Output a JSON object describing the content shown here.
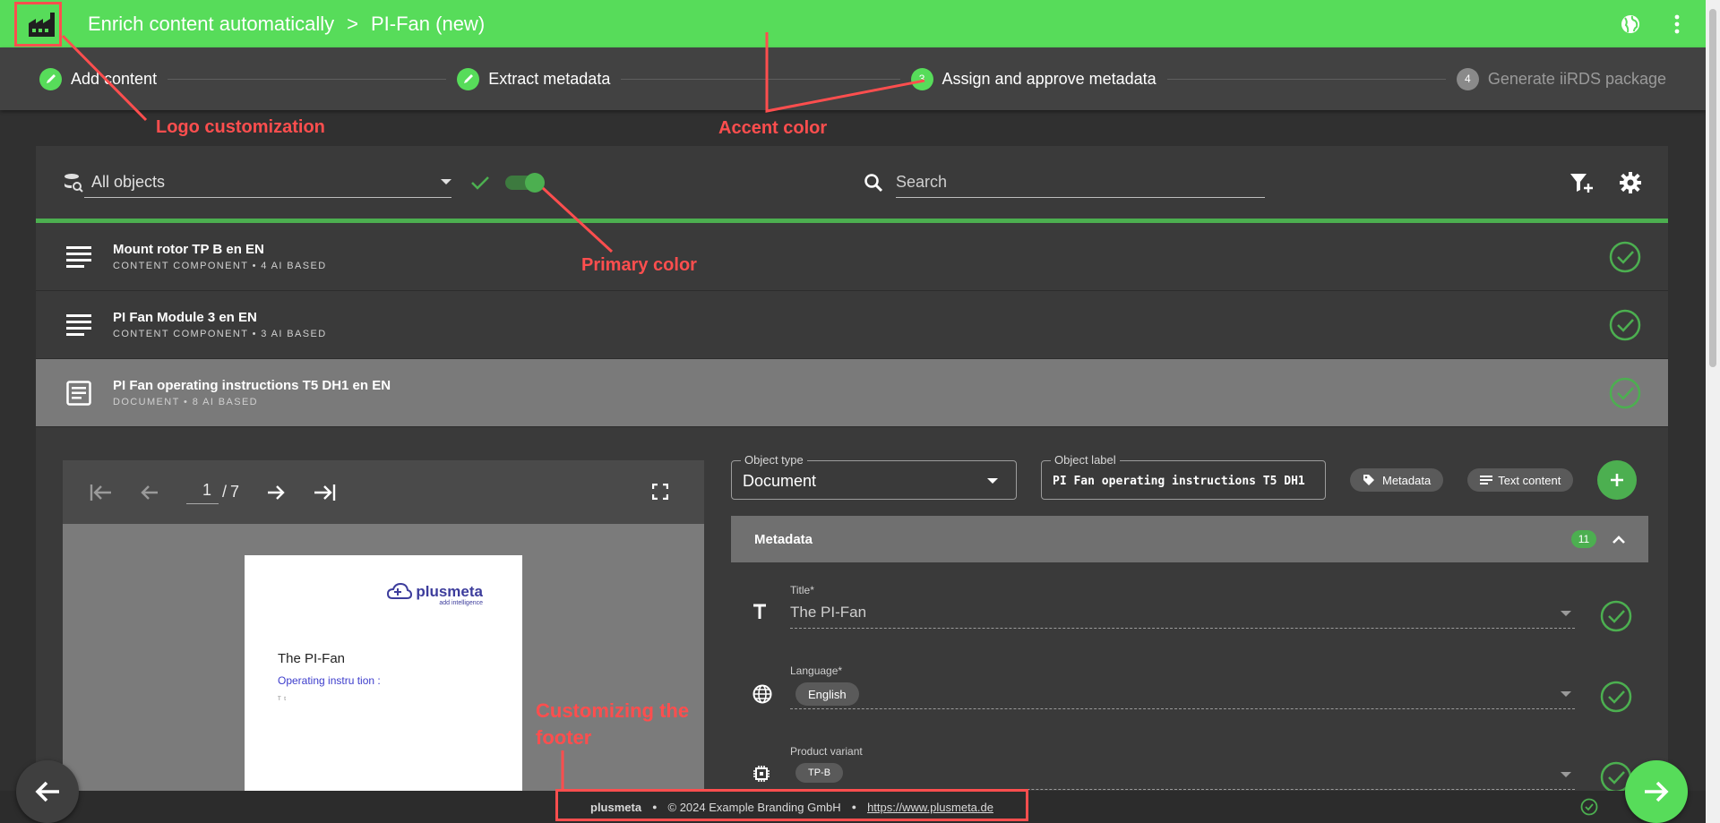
{
  "colors": {
    "accent": "#57dc5a",
    "primary": "#4caf50",
    "annotation": "#ff4e4e"
  },
  "header": {
    "breadcrumb_root": "Enrich content automatically",
    "breadcrumb_sep": ">",
    "breadcrumb_current": "PI-Fan (new)",
    "logo_icon": "factory-icon",
    "icons": [
      "globe-icon",
      "more-vert-icon"
    ]
  },
  "stepper": {
    "steps": [
      {
        "label": "Add content",
        "state": "done"
      },
      {
        "label": "Extract metadata",
        "state": "done"
      },
      {
        "label": "Assign and approve metadata",
        "number": "3",
        "state": "active"
      },
      {
        "label": "Generate iiRDS package",
        "number": "4",
        "state": "disabled"
      }
    ]
  },
  "annotations": {
    "logo": "Logo customization",
    "accent": "Accent color",
    "primary": "Primary color",
    "footer_line1": "Customizing the",
    "footer_line2": "footer"
  },
  "toolbar": {
    "filter_value": "All objects",
    "search_placeholder": "Search"
  },
  "objects": [
    {
      "title": "Mount rotor TP B en EN",
      "subtitle": "CONTENT COMPONENT • 4 AI BASED",
      "icon": "text-lines-icon"
    },
    {
      "title": "PI Fan Module 3 en EN",
      "subtitle": "CONTENT COMPONENT • 3 AI BASED",
      "icon": "text-lines-icon"
    },
    {
      "title": "PI Fan operating instructions T5 DH1 en EN",
      "subtitle": "DOCUMENT • 8 AI BASED",
      "icon": "document-icon"
    }
  ],
  "viewer": {
    "current_page": "1",
    "page_sep": "/",
    "total_pages": "7",
    "doc_brand": "plusmeta",
    "doc_tagline": "add intelligence",
    "doc_title": "The PI-Fan",
    "doc_subtitle": "Operating instru  tion :",
    "doc_tiny": "T   t"
  },
  "form": {
    "object_type_label": "Object type",
    "object_type_value": "Document",
    "object_label_label": "Object label",
    "object_label_value": "PI Fan operating instructions T5 DH1",
    "chip_metadata": "Metadata",
    "chip_text": "Text content"
  },
  "metadata": {
    "title": "Metadata",
    "count": "11",
    "fields": [
      {
        "label": "Title*",
        "value": "The PI-Fan",
        "icon": "title-icon"
      },
      {
        "label": "Language*",
        "value": "English",
        "icon": "globe-icon"
      },
      {
        "label": "Product variant",
        "value": "TP-B",
        "icon": "chip-icon"
      }
    ]
  },
  "footer": {
    "brand": "plusmeta",
    "bullet": "●",
    "copyright": "© 2024 Example Branding GmbH",
    "link": "https://www.plusmeta.de"
  }
}
